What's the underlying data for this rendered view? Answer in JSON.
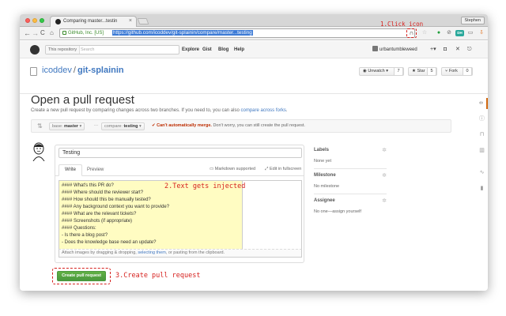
{
  "browser": {
    "tab_title": "Comparing master...testin",
    "tab_close": "×",
    "profile": "Stephen",
    "back": "←",
    "forward": "→",
    "reload": "C",
    "home": "⌂",
    "ev_label": "GitHub, Inc. [US]",
    "url": "https://github.com/icoddev/git-splainin/compare/master...testing",
    "extension_icon": "∩",
    "star": "☆",
    "menu": "≡"
  },
  "annotations": {
    "step1": "1.Click icon",
    "step2": "2.Text gets injected",
    "step3": "3.Create pull request"
  },
  "github_header": {
    "scope_label": "This repository",
    "search_placeholder": "Search",
    "nav": [
      "Explore",
      "Gist",
      "Blog",
      "Help"
    ],
    "username": "urbantumbleweed",
    "plus": "+▾"
  },
  "repo": {
    "owner": "icoddev",
    "name": "git-splainin",
    "unwatch_label": "◉ Unwatch ▾",
    "unwatch_count": "7",
    "star_label": "★ Star",
    "star_count": "5",
    "fork_label": "Fork",
    "fork_count": "0"
  },
  "page": {
    "title": "Open a pull request",
    "subtitle": "Create a new pull request by comparing changes across two branches. If you need to, you can also ",
    "subtitle_link": "compare across forks",
    "subtitle_end": "."
  },
  "range": {
    "base_prefix": "base: ",
    "base_branch": "master",
    "compare_prefix": "compare: ",
    "compare_branch": "testing",
    "dots": "...",
    "merge_bad": "✔ Can't automatically merge.",
    "merge_rest": " Don't worry, you can still create the pull request."
  },
  "pr_form": {
    "title_value": "Testing",
    "tab_write": "Write",
    "tab_preview": "Preview",
    "markdown_note": "Markdown supported",
    "fullscreen_note": "Edit in fullscreen",
    "body_lines": [
      "#### What's this PR do?",
      "#### Where should the reviewer start?",
      "#### How should this be manually tested?",
      "#### Any background context you want to provide?",
      "#### What are the relevant tickets?",
      "#### Screenshots (if appropriate)",
      "#### Questions:",
      "- Is there a blog post?",
      "- Does the knowledge base need an update?"
    ],
    "attach_text": "Attach images by dragging & dropping, ",
    "attach_link": "selecting them",
    "attach_end": ", or pasting from the clipboard.",
    "create_button": "Create pull request"
  },
  "sidebar": {
    "labels_head": "Labels",
    "labels_value": "None yet",
    "milestone_head": "Milestone",
    "milestone_value": "No milestone",
    "assignee_head": "Assignee",
    "assignee_value": "No one—assign yourself"
  },
  "repo_nav_icons": [
    "code-icon",
    "issue-icon",
    "pull-request-icon",
    "wiki-icon",
    "pulse-icon",
    "graph-icon"
  ],
  "colors": {
    "link": "#4078c0",
    "create_green": "#4a993e",
    "annotation_red": "#d6221f",
    "injected_bg": "#fffcc2",
    "merge_fail": "#bd2c00"
  }
}
